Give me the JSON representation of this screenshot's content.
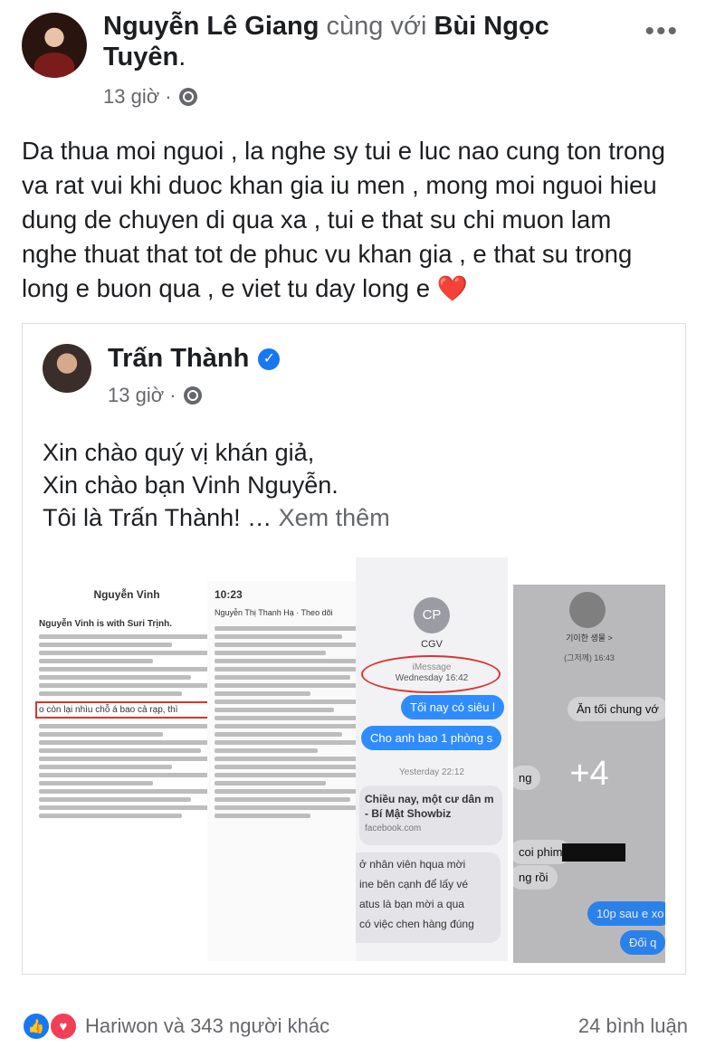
{
  "post": {
    "author": "Nguyễn Lê Giang",
    "with_word": "cùng với",
    "tagged": "Bùi Ngọc Tuyên",
    "time": "13 giờ ·",
    "more": "•••",
    "text": "Da thua moi nguoi , la nghe sy tui e luc nao cung ton trong va rat vui khi duoc khan gia iu men , mong moi nguoi hieu dung de chuyen di qua xa , tui e that su chi muon lam nghe thuat that tot de phuc vu khan gia , e that su trong long e buon qua , e viet tu day long e",
    "heart": "❤️"
  },
  "shared": {
    "author": "Trấn Thành",
    "verified_icon": "✓",
    "time": "13 giờ ·",
    "line1": "Xin chào quý vị khán giả,",
    "line2": "Xin chào bạn Vinh Nguyễn.",
    "line3": "Tôi là Trấn Thành! …",
    "see_more": "Xem thêm",
    "gallery": {
      "shot1_title": "Nguyễn Vinh",
      "shot1_sub": "Nguyễn Vinh is with Suri Trịnh.",
      "shot1_highlight": "o còn lại nhìu chỗ á bao cả rạp, thì",
      "shot2_time": "10:23",
      "shot2_author": "Nguyễn Thị Thanh Hạ · Theo dõi",
      "shot3_contact": "CGV",
      "shot3_initials": "CP",
      "shot3_imessage": "iMessage",
      "shot3_date": "Wednesday 16:42",
      "shot3_msg1": "Tối nay có siêu l",
      "shot3_msg2": "Cho anh bao 1 phòng s",
      "shot3_yesterday": "Yesterday 22:12",
      "shot3_link": "Chiều nay, một cư dân m",
      "shot3_link2": "- Bí Mật Showbiz",
      "shot3_domain": "facebook.com",
      "shot3_msg3": "ở nhân viên hqua mời",
      "shot3_msg4": "ine bên cạnh để lấy vé",
      "shot3_msg5": "atus là bạn mời a qua",
      "shot3_msg6": "có việc chen hàng đúng",
      "shot4_name": "기이한 생물 >",
      "shot4_time": "(그저께) 16:43",
      "shot4_msg1": "Ăn tối chung vớ",
      "shot4_msg2": "ng",
      "shot4_msg3": "coi phim",
      "shot4_msg4": "ng rồi",
      "shot4_msg5": "10p sau e xo",
      "shot4_msg6": "Đối q",
      "more_count": "+4"
    }
  },
  "footer": {
    "like_icon": "👍",
    "love_icon": "♥",
    "reactions": "Hariwon và 343 người khác",
    "comments": "24 bình luận"
  },
  "colors": {
    "link_blue": "#1877f2",
    "heart_red": "#e41e3f",
    "muted": "#65676b"
  }
}
